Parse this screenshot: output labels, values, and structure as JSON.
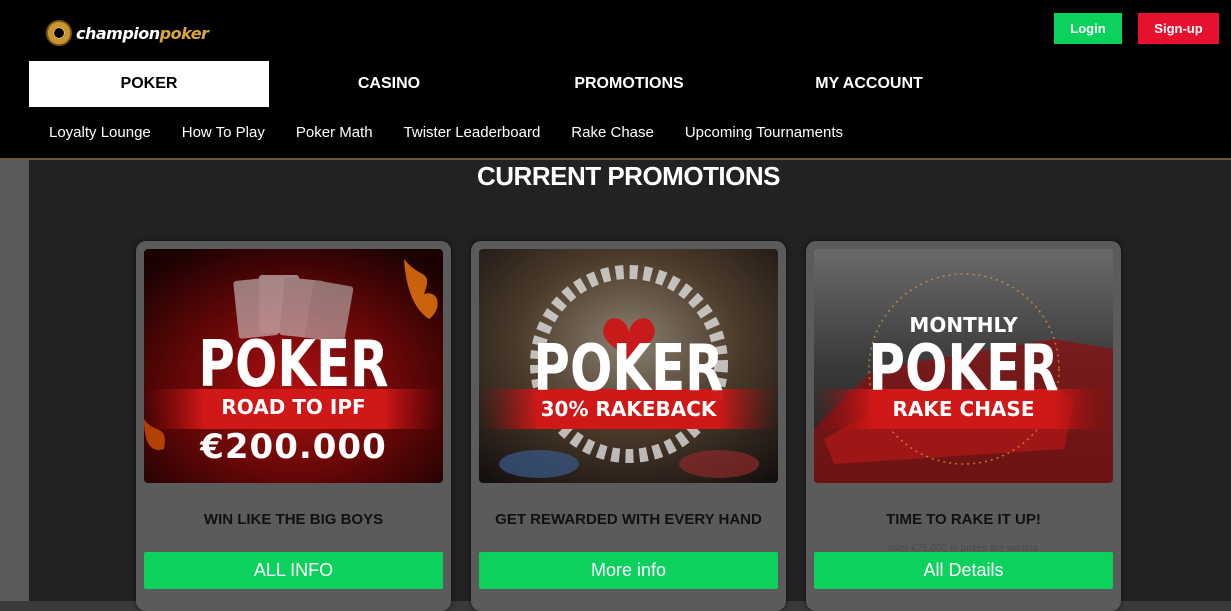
{
  "brand": {
    "part1": "champion",
    "part2": "poker"
  },
  "header": {
    "login_label": "Login",
    "signup_label": "Sign-up"
  },
  "main_nav": {
    "tabs": [
      {
        "label": "POKER"
      },
      {
        "label": "CASINO"
      },
      {
        "label": "PROMOTIONS"
      },
      {
        "label": "MY ACCOUNT"
      }
    ]
  },
  "sub_nav": {
    "items": [
      {
        "label": "Loyalty Lounge"
      },
      {
        "label": "How To Play"
      },
      {
        "label": "Poker Math"
      },
      {
        "label": "Twister Leaderboard"
      },
      {
        "label": "Rake Chase"
      },
      {
        "label": "Upcoming Tournaments"
      }
    ]
  },
  "page": {
    "heading": "CURRENT PROMOTIONS"
  },
  "cards": [
    {
      "banner_top": "",
      "banner_main": "POKER",
      "banner_strip": "ROAD TO IPF",
      "banner_bottom": "€200.000",
      "tagline": "WIN LIKE THE BIG BOYS",
      "subtext": "",
      "cta": "ALL INFO"
    },
    {
      "banner_top": "",
      "banner_main": "POKER",
      "banner_strip": "30% RAKEBACK",
      "banner_bottom": "",
      "tagline": "GET REWARDED WITH EVERY HAND",
      "subtext": "",
      "cta": "More info"
    },
    {
      "banner_top": "MONTHLY",
      "banner_main": "POKER",
      "banner_strip": "RAKE CHASE",
      "banner_bottom": "",
      "tagline": "TIME TO RAKE IT UP!",
      "subtext": "over €25.000 in prizes are waiting",
      "cta": "All Details"
    }
  ],
  "colors": {
    "accent_green": "#0cd25d",
    "signup_red": "#e8102f",
    "gold": "#d9a53f"
  }
}
